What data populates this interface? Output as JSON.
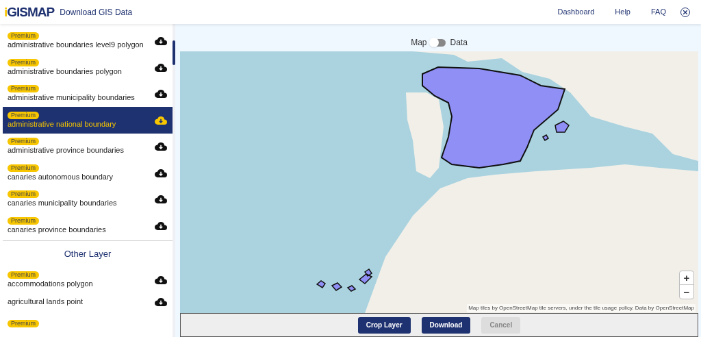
{
  "header": {
    "logo": "iGISMAP",
    "title": "Download GIS Data",
    "nav": [
      "Dashboard",
      "Help",
      "FAQ"
    ]
  },
  "layers": [
    {
      "badge": "Premium",
      "label": "administrative boundaries level9 polygon",
      "selected": false
    },
    {
      "badge": "Premium",
      "label": "administrative boundaries polygon",
      "selected": false
    },
    {
      "badge": "Premium",
      "label": "administrative municipality boundaries",
      "selected": false
    },
    {
      "badge": "Premium",
      "label": "administrative national boundary",
      "selected": true
    },
    {
      "badge": "Premium",
      "label": "administrative province boundaries",
      "selected": false
    },
    {
      "badge": "Premium",
      "label": "canaries autonomous boundary",
      "selected": false
    },
    {
      "badge": "Premium",
      "label": "canaries municipality boundaries",
      "selected": false
    },
    {
      "badge": "Premium",
      "label": "canaries province boundaries",
      "selected": false
    }
  ],
  "other_layer": {
    "heading": "Other Layer",
    "items": [
      {
        "badge": "Premium",
        "label": "accommodations polygon",
        "selected": false
      },
      {
        "label": "agricultural lands point",
        "selected": false
      },
      {
        "badge": "Premium",
        "selected": false
      }
    ]
  },
  "view_toggle": {
    "left_label": "Map",
    "right_label": "Data",
    "on": false
  },
  "map": {
    "zoom_in": "+",
    "zoom_out": "−",
    "attribution": "Map tiles by OpenStreetMap tile servers, under the tile usage policy. Data by OpenStreetMap"
  },
  "buttons": [
    {
      "label": "Crop Layer",
      "disabled": false
    },
    {
      "label": "Download",
      "disabled": false
    },
    {
      "label": "Cancel",
      "disabled": true
    }
  ]
}
